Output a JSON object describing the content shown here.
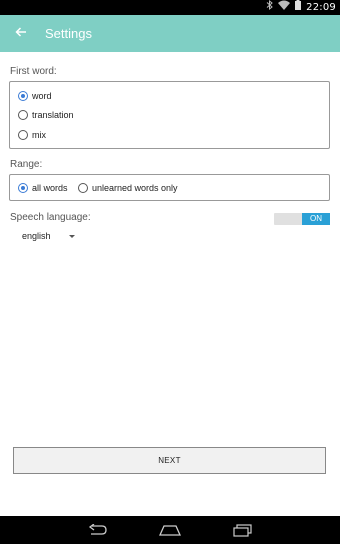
{
  "status_bar": {
    "time": "22:09",
    "icons": [
      "bluetooth-icon",
      "wifi-icon",
      "battery-icon"
    ]
  },
  "app_bar": {
    "title": "Settings",
    "back_icon": "arrow-left-icon"
  },
  "first_word": {
    "label": "First word:",
    "options": [
      "word",
      "translation",
      "mix"
    ],
    "selected": "word"
  },
  "range": {
    "label": "Range:",
    "options": [
      "all words",
      "unlearned words only"
    ],
    "selected": "all words"
  },
  "speech": {
    "label": "Speech language:",
    "toggle_label": "ON",
    "toggle_state": "on",
    "language": "english"
  },
  "actions": {
    "next_label": "NEXT"
  },
  "nav_bar": {
    "icons": [
      "back-nav-icon",
      "home-nav-icon",
      "recents-nav-icon"
    ]
  },
  "colors": {
    "app_bar": "#7fcfc4",
    "accent": "#3a7bd5",
    "toggle_on": "#2aa0d6"
  }
}
